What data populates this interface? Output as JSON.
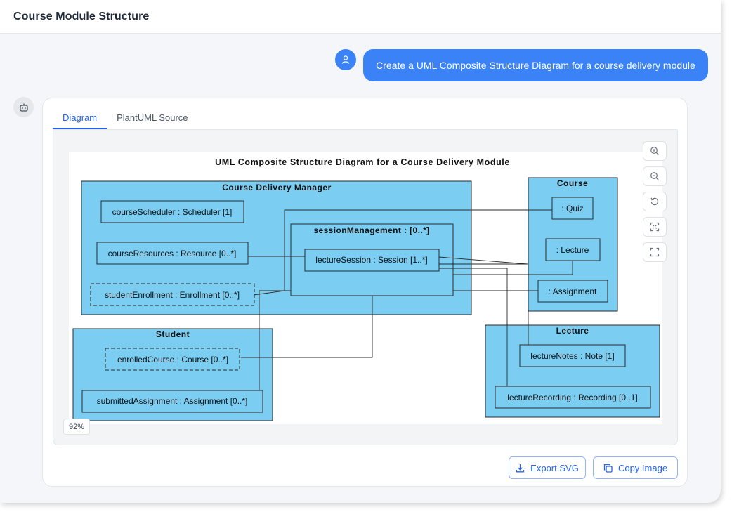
{
  "header": {
    "title": "Course Module Structure"
  },
  "chat": {
    "user_message": "Create a UML Composite Structure Diagram for a course delivery module"
  },
  "tabs": [
    {
      "label": "Diagram",
      "active": true
    },
    {
      "label": "PlantUML Source",
      "active": false
    }
  ],
  "zoom": {
    "level": "92%"
  },
  "actions": {
    "export_label": "Export SVG",
    "copy_label": "Copy Image"
  },
  "diagram": {
    "title": "UML Composite Structure Diagram for a Course Delivery Module",
    "containers": {
      "cdm": "Course Delivery Manager",
      "session": "sessionManagement : [0..*]",
      "course": "Course",
      "student": "Student",
      "lecture": "Lecture"
    },
    "parts": {
      "scheduler": "courseScheduler : Scheduler [1]",
      "resources": "courseResources : Resource [0..*]",
      "enrollment": "studentEnrollment : Enrollment [0..*]",
      "lecture_session": "lectureSession : Session [1..*]",
      "quiz": ": Quiz",
      "course_lecture": ": Lecture",
      "assignment": ": Assignment",
      "enrolled_course": "enrolledCourse : Course [0..*]",
      "submitted_assignment": "submittedAssignment : Assignment [0..*]",
      "lecture_notes": "lectureNotes : Note [1]",
      "lecture_recording": "lectureRecording : Recording [0..1]"
    }
  },
  "colors": {
    "accent": "#3b82f6",
    "diagram_fill": "#7ccdf2",
    "diagram_stroke": "#2a2a2a"
  }
}
